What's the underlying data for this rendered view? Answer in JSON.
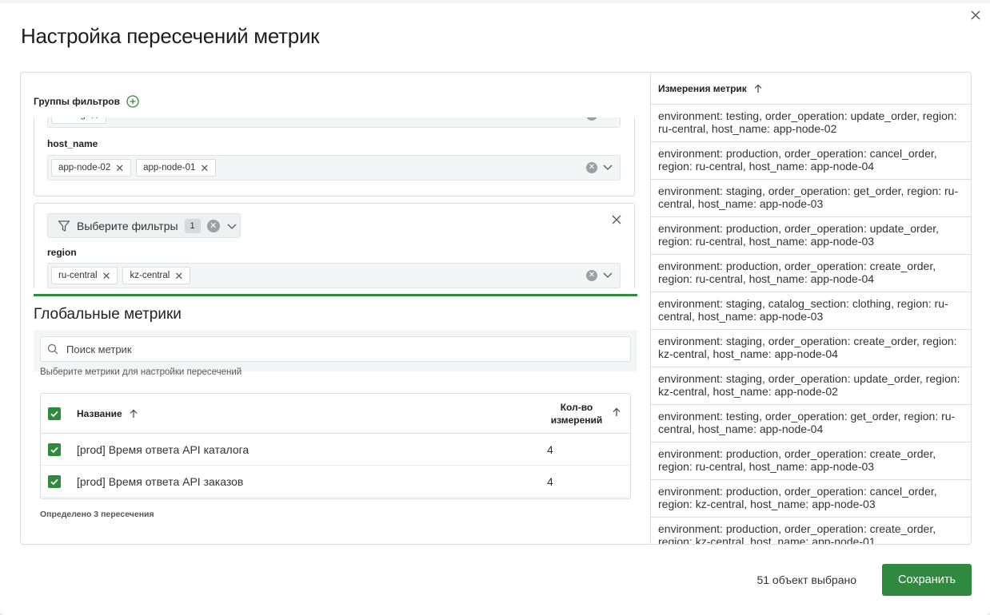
{
  "dialog": {
    "title": "Настройка пересечений метрик",
    "close_icon": "close-icon"
  },
  "filter_groups": {
    "header": "Группы фильтров",
    "add_icon": "plus-circle-icon",
    "group1": {
      "top_chips": [
        "testing"
      ],
      "field_label": "host_name",
      "field_chips": [
        "app-node-02",
        "app-node-01"
      ]
    },
    "group2": {
      "filter_button_label": "Выберите фильтры",
      "filter_count": "1",
      "field_label": "region",
      "field_chips": [
        "ru-central",
        "kz-central"
      ]
    }
  },
  "global_metrics": {
    "title": "Глобальные метрики",
    "search_placeholder": "Поиск метрик",
    "hint": "Выберите метрики для настройки пересечений",
    "columns": {
      "name": "Название",
      "count_line1": "Кол-во",
      "count_line2": "измерений"
    },
    "rows": [
      {
        "name": "[prod] Время ответа API каталога",
        "count": "4",
        "checked": true
      },
      {
        "name": "[prod] Время ответа API заказов",
        "count": "4",
        "checked": true
      }
    ],
    "footer": "Определено 3 пересечения"
  },
  "dimensions": {
    "header": "Измерения метрик",
    "items": [
      "environment: testing, order_operation: update_order, region: ru-central, host_name: app-node-02",
      "environment: production, order_operation: cancel_order, region: ru-central, host_name: app-node-04",
      "environment: staging, order_operation: get_order, region: ru-central, host_name: app-node-03",
      "environment: production, order_operation: update_order, region: ru-central, host_name: app-node-03",
      "environment: production, order_operation: create_order, region: ru-central, host_name: app-node-04",
      "environment: staging, catalog_section: clothing, region: ru-central, host_name: app-node-03",
      "environment: staging, order_operation: create_order, region: kz-central, host_name: app-node-04",
      "environment: staging, order_operation: update_order, region: kz-central, host_name: app-node-02",
      "environment: testing, order_operation: get_order, region: ru-central, host_name: app-node-04",
      "environment: production, order_operation: create_order, region: ru-central, host_name: app-node-03",
      "environment: production, order_operation: cancel_order, region: kz-central, host_name: app-node-03",
      "environment: production, order_operation: create_order, region: kz-central, host_name: app-node-01"
    ]
  },
  "footer": {
    "status": "51 объект выбрано",
    "save_label": "Сохранить"
  },
  "colors": {
    "accent": "#2f8a3f"
  }
}
